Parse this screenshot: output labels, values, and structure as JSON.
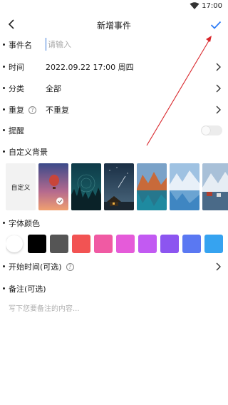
{
  "status_bar": {
    "time": "17:00",
    "wifi_icon": "wifi-icon"
  },
  "nav": {
    "title": "新增事件",
    "back_icon": "back-arrow-icon",
    "confirm_icon": "checkmark-icon",
    "confirm_color": "#2f7df6"
  },
  "form": {
    "event_name": {
      "label": "事件名",
      "placeholder": "请输入",
      "value": ""
    },
    "time": {
      "label": "时间",
      "value": "2022.09.22 17:00 周四"
    },
    "category": {
      "label": "分类",
      "value": "全部"
    },
    "repeat": {
      "label": "重复",
      "help": "?",
      "value": "不重复"
    },
    "reminder": {
      "label": "提醒",
      "enabled": false
    },
    "background": {
      "label": "自定义背景",
      "custom_label": "自定义",
      "selected_index": 0,
      "images": [
        "hot-air-balloon-sunset",
        "starry-forest",
        "night-cabin-meteor",
        "mountain-lake",
        "glacier-lake",
        "snowy-mountain-village"
      ]
    },
    "font_color": {
      "label": "字体颜色",
      "swatches": [
        "#ffffff",
        "#000000",
        "#555555",
        "#f25353",
        "#f05aa3",
        "#e55bd9",
        "#c25af2",
        "#8c55f0",
        "#5a78f2",
        "#36a3f0"
      ]
    },
    "start_time": {
      "label": "开始时间(可选)",
      "help": "?"
    },
    "notes": {
      "label": "备注(可选)",
      "placeholder": "写下您要备注的内容..."
    }
  },
  "annotation": {
    "arrow_color": "#d9262b"
  }
}
